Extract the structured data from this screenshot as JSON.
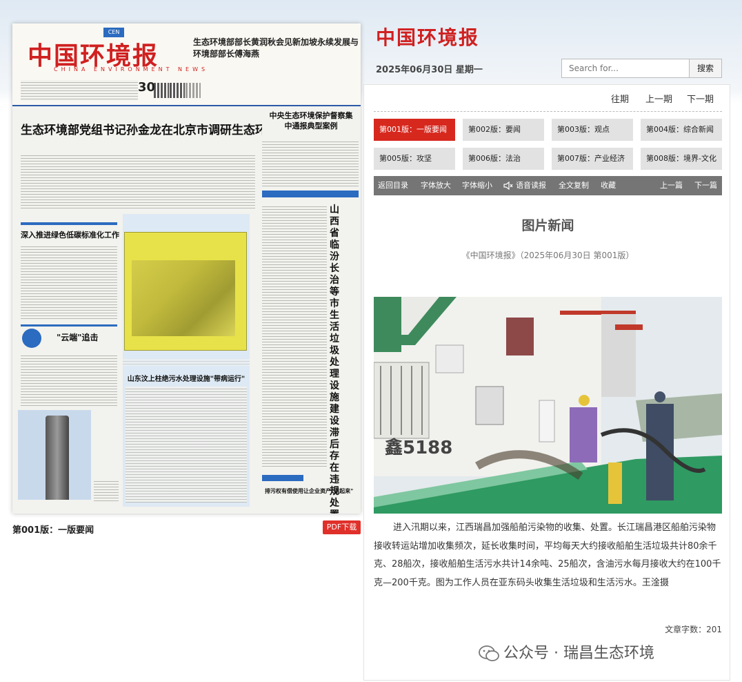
{
  "newspaper": {
    "masthead_logo": "中国环境报",
    "masthead_en": "CHINA ENVIRONMENT NEWS",
    "masthead_badge": "CEN",
    "masthead_side_headline": "生态环境部部长黄润秋会见新加坡永续发展与环境部部长傅海燕",
    "masthead_date_num": "30",
    "lead_headline": "生态环境部党组书记孙金龙在北京市调研生态环境保护工作",
    "sub_headline_1": "深入推进绿色低碳标准化工作",
    "sub_headline_2": "\"云端\"追击",
    "sub_headline_3": "山东汶上柱绝污水处理设施\"带病运行\"",
    "right_headline": "中央生态环境保护督察集中通报典型案例",
    "vertical_headline": "山西省临汾长治等市生活垃圾处理设施建设滞后 存在违规处置问题",
    "bottom_right_headline": "排污权有偿使用让企业资产\"活起来\"",
    "page_label": "第001版：一版要闻",
    "pdf_button": "PDF下载"
  },
  "site": {
    "brand": "中国环境报",
    "date": "2025年06月30日 星期一",
    "search_placeholder": "Search for...",
    "search_button": "搜索"
  },
  "issue_nav": [
    "往期",
    "上一期",
    "下一期"
  ],
  "editions": [
    {
      "label": "第001版：一版要闻",
      "active": true
    },
    {
      "label": "第002版：要闻",
      "active": false
    },
    {
      "label": "第003版：观点",
      "active": false
    },
    {
      "label": "第004版：综合新闻",
      "active": false
    },
    {
      "label": "第005版：攻坚",
      "active": false
    },
    {
      "label": "第006版：法治",
      "active": false
    },
    {
      "label": "第007版：产业经济",
      "active": false
    },
    {
      "label": "第008版：境界-文化",
      "active": false
    }
  ],
  "toolbar": {
    "back": "返回目录",
    "font_bigger": "字体放大",
    "font_smaller": "字体缩小",
    "voice": "语音读报",
    "copy": "全文复制",
    "favorite": "收藏",
    "prev": "上一篇",
    "next": "下一篇"
  },
  "article": {
    "title": "图片新闻",
    "source": "《中国环境报》（2025年06月30日 第001版）",
    "photo_ship_text": "鑫5188",
    "body": "进入汛期以来，江西瑞昌加强船舶污染物的收集、处置。长江瑞昌港区船舶污染物接收转运站增加收集频次，延长收集时间，平均每天大约接收船舶生活垃圾共计80余千克、28船次，接收船舶生活污水共计14余吨、25船次，含油污水每月接收大约在100千克—200千克。图为工作人员在亚东码头收集生活垃圾和生活污水。王淦摄",
    "word_count": "文章字数：201"
  },
  "watermark": "公众号 · 瑞昌生态环境",
  "colors": {
    "accent_red": "#d7281e",
    "toolbar_gray": "#757575",
    "edition_gray": "#e2e2e2",
    "logo_red": "#d02020"
  }
}
